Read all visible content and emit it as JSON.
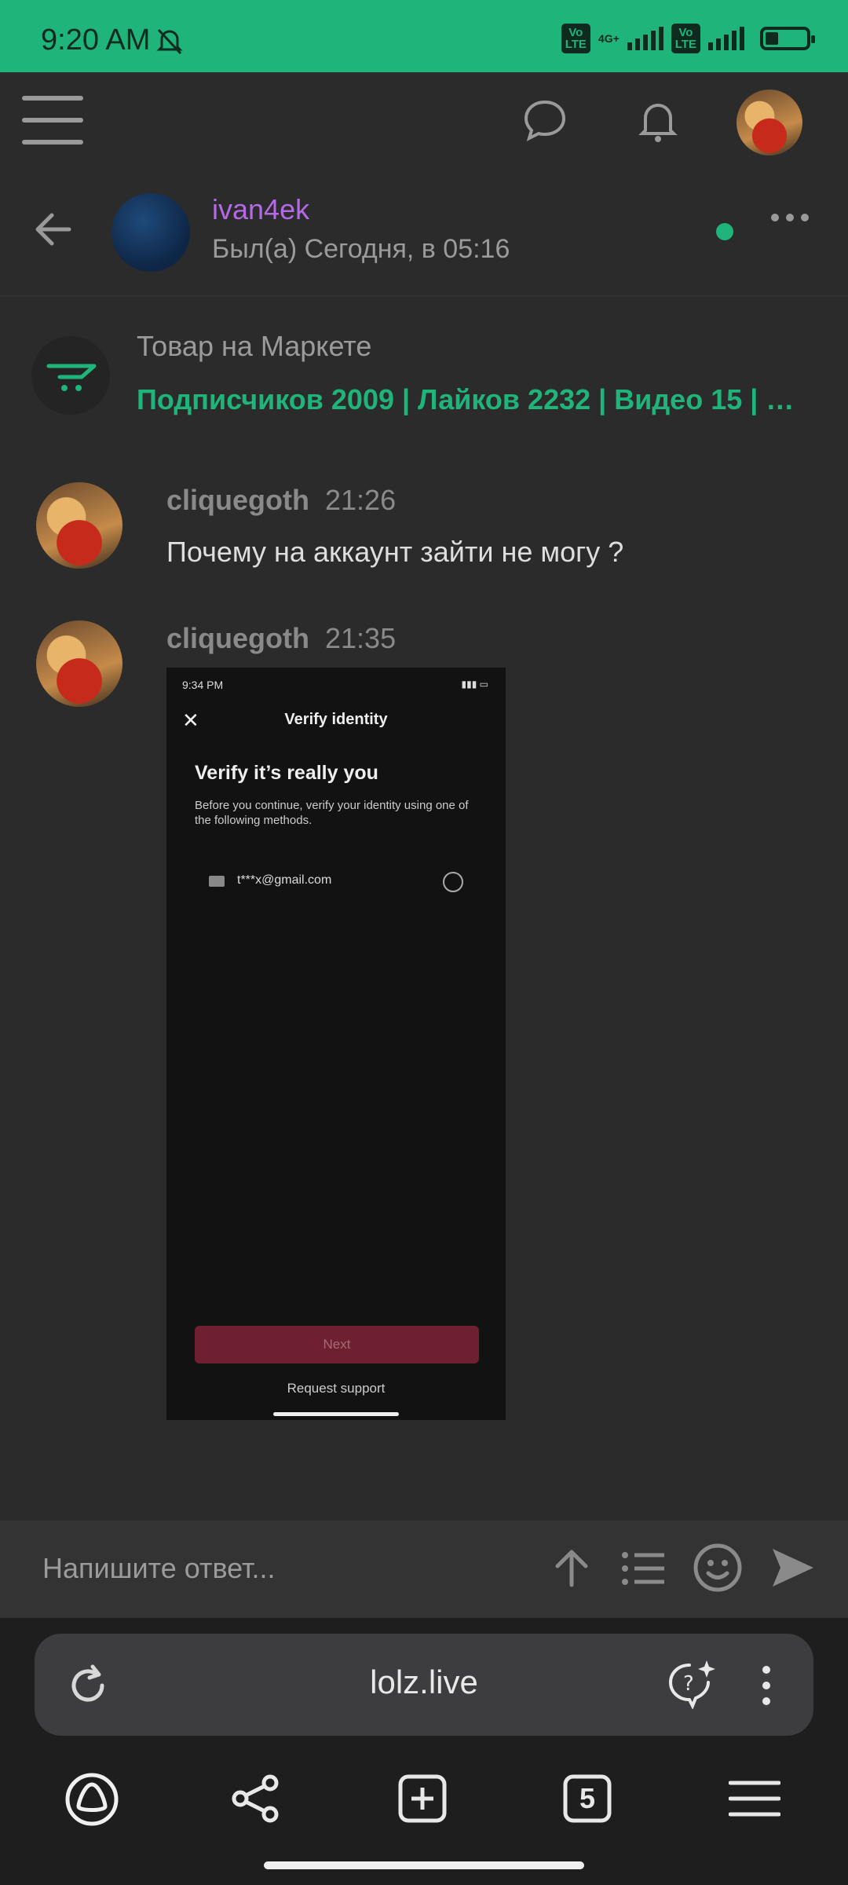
{
  "status_bar": {
    "time": "9:20 AM",
    "network": "4G+",
    "volte": "Vo\nLTE"
  },
  "chat": {
    "username": "ivan4ek",
    "last_seen": "Был(а) Сегодня, в 05:16"
  },
  "market": {
    "title": "Товар на Маркете",
    "stats": "Подписчиков 2009 | Лайков 2232 | Видео 15 | Подп…"
  },
  "messages": [
    {
      "author": "cliquegoth",
      "time": "21:26",
      "text": "Почему на аккаунт зайти не могу ?"
    },
    {
      "author": "cliquegoth",
      "time": "21:35"
    }
  ],
  "attachment": {
    "status_time": "9:34 PM",
    "title": "Verify identity",
    "heading": "Verify it’s really you",
    "description": "Before you continue, verify your identity using one of the following methods.",
    "email": "t***x@gmail.com",
    "next_label": "Next",
    "support_label": "Request support"
  },
  "reply": {
    "placeholder": "Напишите ответ..."
  },
  "browser": {
    "url": "lolz.live",
    "tab_count": "5"
  },
  "colors": {
    "accent": "#1fb47a",
    "username": "#b46ae6",
    "background": "#2b2b2b"
  }
}
